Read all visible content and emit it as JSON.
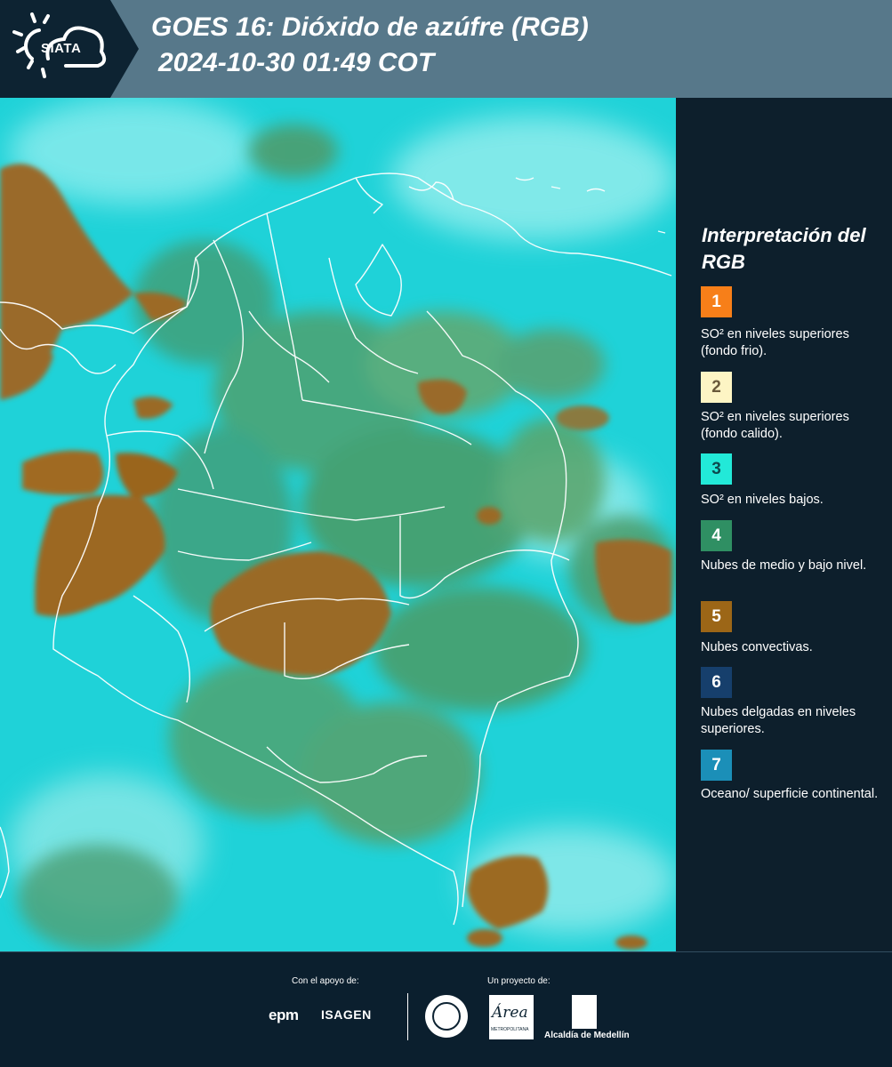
{
  "header": {
    "logo_text": "SIATA",
    "title_line1": "GOES 16: Dióxido de azúfre (RGB)",
    "title_line2": "2024-10-30 01:49 COT"
  },
  "legend": {
    "title": "Interpretación del RGB",
    "items": [
      {
        "number": "1",
        "color": "#f77f19",
        "text_color": "#ffffff",
        "description": "SO² en niveles superiores (fondo frio)."
      },
      {
        "number": "2",
        "color": "#fdf5c4",
        "text_color": "#6a5a3a",
        "description": "SO² en niveles superiores (fondo calido)."
      },
      {
        "number": "3",
        "color": "#22e9d8",
        "text_color": "#0d4a4e",
        "description": "SO² en niveles bajos."
      },
      {
        "number": "4",
        "color": "#2f8f63",
        "text_color": "#ffffff",
        "description": "Nubes de medio y bajo nivel."
      },
      {
        "number": "5",
        "color": "#9c6617",
        "text_color": "#ffffff",
        "description": "Nubes convectivas."
      },
      {
        "number": "6",
        "color": "#163f6c",
        "text_color": "#ffffff",
        "description": "Nubes delgadas en niveles superiores."
      },
      {
        "number": "7",
        "color": "#1b8fb8",
        "text_color": "#ffffff",
        "description": "Oceano/ superficie continental."
      }
    ]
  },
  "footer": {
    "support_label": "Con el apoyo de:",
    "project_label": "Un proyecto de:",
    "sponsor1": "epm",
    "sponsor2": "ISAGEN",
    "partner_area": "Área",
    "partner_area_sub": "METROPOLITANA",
    "partner_alcaldia": "Alcaldía de Medellín"
  },
  "colors": {
    "header_bg": "#57788a",
    "panel_bg": "#0d1f2c",
    "cyan_background": "#1fd2d8",
    "convective": "#9c6617",
    "mid_low_cloud": "#2f8f63"
  }
}
